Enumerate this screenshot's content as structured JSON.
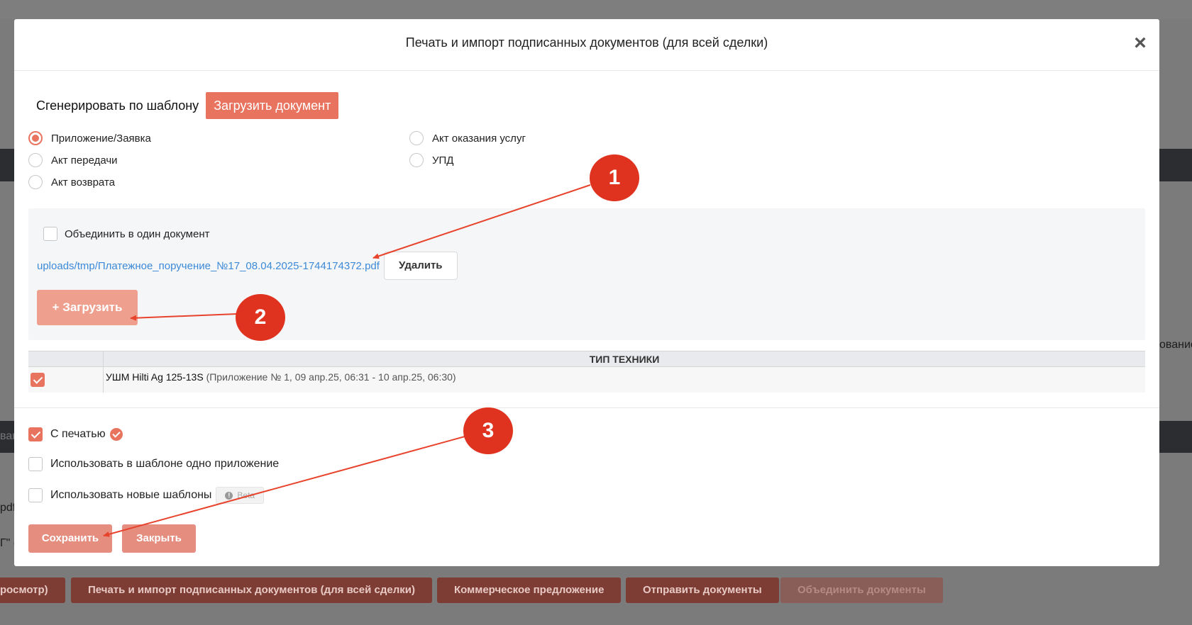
{
  "background": {
    "partial_texts": [
      "ование",
      "вак",
      "pdf",
      "Г\" (",
      "росмотр)"
    ],
    "buttons": [
      {
        "label": "росмотр)",
        "disabled": false
      },
      {
        "label": "Печать и импорт подписанных документов (для всей сделки)",
        "disabled": false
      },
      {
        "label": "Коммерческое предложение",
        "disabled": false
      },
      {
        "label": "Отправить документы",
        "disabled": false
      },
      {
        "label": "Объединить документы",
        "disabled": true
      }
    ]
  },
  "modal": {
    "title": "Печать и импорт подписанных документов (для всей сделки)",
    "close_icon": "×",
    "generate_label": "Сгенерировать по шаблону",
    "upload_document_label": "Загрузить документ",
    "doc_types": [
      {
        "label": "Приложение/Заявка",
        "checked": true
      },
      {
        "label": "Акт передачи",
        "checked": false
      },
      {
        "label": "Акт возврата",
        "checked": false
      },
      {
        "label": "Акт оказания услуг",
        "checked": false
      },
      {
        "label": "УПД",
        "checked": false
      }
    ],
    "upload_panel": {
      "merge_label": "Объединить в один документ",
      "merge_checked": false,
      "file_link": "uploads/tmp/Платежное_поручение_№17_08.04.2025-1744174372.pdf",
      "delete_label": "Удалить",
      "load_label": "+ Загрузить"
    },
    "equipment_table": {
      "header": "ТИП ТЕХНИКИ",
      "rows": [
        {
          "checked": true,
          "name": "УШМ Hilti Ag 125-13S",
          "detail": "(Приложение № 1, 09 апр.25, 06:31 - 10 апр.25, 06:30)"
        }
      ]
    },
    "options": {
      "with_stamp": {
        "label": "С печатью",
        "checked": true
      },
      "single_attachment": {
        "label": "Использовать в шаблоне одно приложение",
        "checked": false
      },
      "new_templates": {
        "label": "Использовать новые шаблоны",
        "checked": false,
        "beta_label": "Beta",
        "info_icon": "!"
      }
    },
    "save_label": "Сохранить",
    "close_label": "Закрыть"
  },
  "annotations": [
    "1",
    "2",
    "3"
  ],
  "colors": {
    "accent": "#e8745f",
    "annotation": "#df3320",
    "link": "#3c8ad8"
  }
}
